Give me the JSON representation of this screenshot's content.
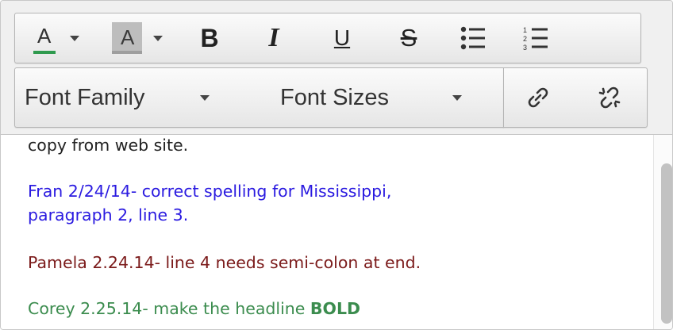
{
  "toolbar": {
    "text_color": {
      "letter": "A",
      "swatch": "#2f9a4e"
    },
    "bg_color": {
      "letter": "A",
      "swatch": "#9e9e9e"
    },
    "bold_label": "B",
    "italic_label": "I",
    "underline_label": "U",
    "strike_label": "S",
    "font_family_label": "Font Family",
    "font_sizes_label": "Font Sizes"
  },
  "icons": {
    "text_color": "font-color-icon",
    "bg_color": "background-color-icon",
    "bullets": "bullet-list-icon",
    "numbers": "numbered-list-icon",
    "link": "link-icon",
    "unlink": "unlink-icon"
  },
  "content": {
    "line0": "copy from web site.",
    "fran_line1": "Fran 2/24/14- correct spelling for Mississippi,",
    "fran_line2": "paragraph 2, line 3.",
    "pamela": "Pamela 2.24.14- line 4 needs semi-colon at end.",
    "corey_prefix": "Corey 2.25.14- make the headline ",
    "corey_bold": "BOLD"
  },
  "colors": {
    "black_text": "#222222",
    "fran": "#2a1ae0",
    "pamela": "#7b1a1a",
    "corey": "#3b8c4e"
  }
}
